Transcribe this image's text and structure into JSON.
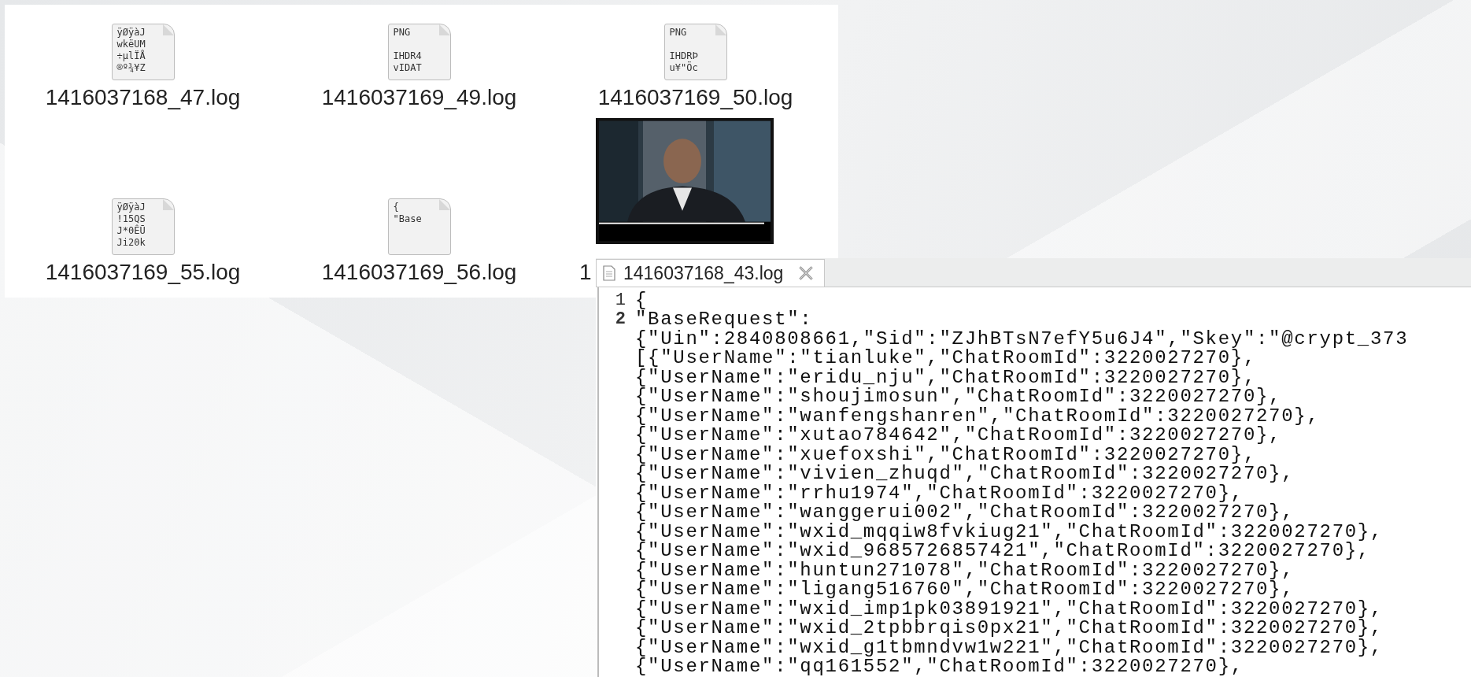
{
  "files": [
    {
      "name": "1416037168_47.log",
      "kind": "text",
      "preview": "ÿØÿàJ\nwkëUM\n÷µlÏÅ\n®º¾¥Z"
    },
    {
      "name": "1416037169_49.log",
      "kind": "text",
      "preview": "PNG\n\nIHDR4\nvIDAT"
    },
    {
      "name": "1416037169_50.log",
      "kind": "text",
      "preview": "PNG\n\nIHDRÞ\nu¥\"Öc"
    },
    {
      "name": "1416037169_55.log",
      "kind": "text",
      "preview": "ÿØÿàJ\n!15QS\nJ*0ÊŪ\nJi20k"
    },
    {
      "name": "1416037169_56.log",
      "kind": "text",
      "preview": "{\n\"Base"
    },
    {
      "name": "1",
      "kind": "picture"
    }
  ],
  "editor": {
    "tab": {
      "title": "1416037168_43.log",
      "selected": true
    },
    "lines": [
      {
        "number": "1",
        "current": false,
        "segments": [
          "{"
        ]
      },
      {
        "number": "2",
        "current": true,
        "segments": [
          "\"BaseRequest\":",
          "{\"Uin\":2840808661,\"Sid\":\"ZJhBTsN7efY5u6J4\",\"Skey\":\"@crypt_373",
          "[{\"UserName\":\"tianluke\",\"ChatRoomId\":3220027270},",
          "{\"UserName\":\"eridu_nju\",\"ChatRoomId\":3220027270},",
          "{\"UserName\":\"shoujimosun\",\"ChatRoomId\":3220027270},",
          "{\"UserName\":\"wanfengshanren\",\"ChatRoomId\":3220027270},",
          "{\"UserName\":\"xutao784642\",\"ChatRoomId\":3220027270},",
          "{\"UserName\":\"xuefoxshi\",\"ChatRoomId\":3220027270},",
          "{\"UserName\":\"vivien_zhuqd\",\"ChatRoomId\":3220027270},",
          "{\"UserName\":\"rrhu1974\",\"ChatRoomId\":3220027270},",
          "{\"UserName\":\"wanggerui002\",\"ChatRoomId\":3220027270},",
          "{\"UserName\":\"wxid_mqqiw8fvkiug21\",\"ChatRoomId\":3220027270},",
          "{\"UserName\":\"wxid_9685726857421\",\"ChatRoomId\":3220027270},",
          "{\"UserName\":\"huntun271078\",\"ChatRoomId\":3220027270},",
          "{\"UserName\":\"ligang516760\",\"ChatRoomId\":3220027270},",
          "{\"UserName\":\"wxid_imp1pk03891921\",\"ChatRoomId\":3220027270},",
          "{\"UserName\":\"wxid_2tpbbrqis0px21\",\"ChatRoomId\":3220027270},",
          "{\"UserName\":\"wxid_g1tbmndvw1w221\",\"ChatRoomId\":3220027270},",
          "{\"UserName\":\"qq161552\",\"ChatRoomId\":3220027270},"
        ]
      }
    ]
  }
}
